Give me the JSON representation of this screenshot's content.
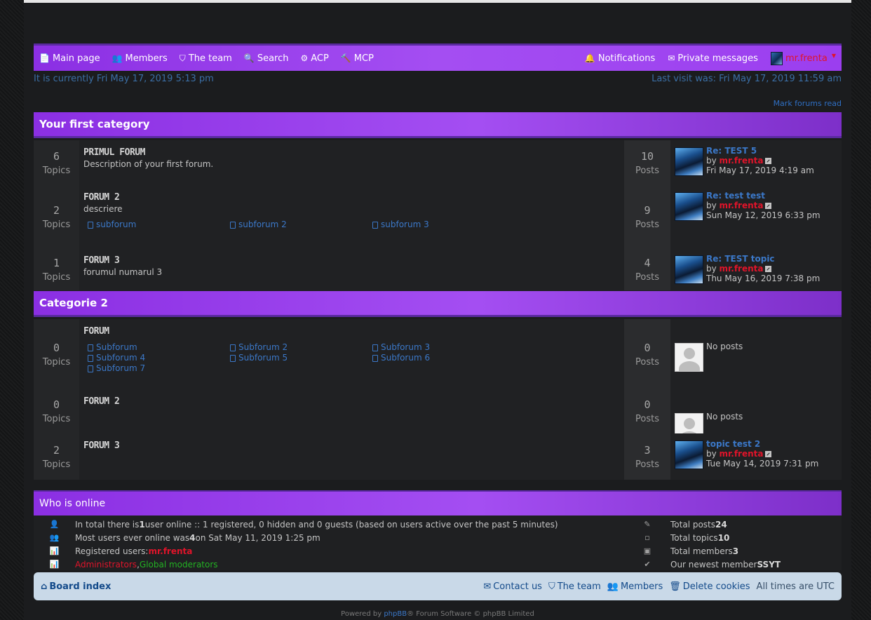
{
  "nav": {
    "items": [
      {
        "icon": "file-icon",
        "glyph": "📄",
        "label": "Main page"
      },
      {
        "icon": "members-icon",
        "glyph": "👥",
        "label": "Members"
      },
      {
        "icon": "shield-icon",
        "glyph": "⛉",
        "label": "The team"
      },
      {
        "icon": "search-icon",
        "glyph": "🔍",
        "label": "Search"
      },
      {
        "icon": "cogs-icon",
        "glyph": "⚙",
        "label": "ACP"
      },
      {
        "icon": "gavel-icon",
        "glyph": "🔨",
        "label": "MCP"
      }
    ],
    "notifications": "Notifications",
    "private_messages": "Private messages",
    "username": "mr.frenta"
  },
  "status": {
    "current_time": "It is currently Fri May 17, 2019 5:13 pm",
    "last_visit": "Last visit was: Fri May 17, 2019 11:59 am",
    "mark_read": "Mark forums read"
  },
  "categories": [
    {
      "title": "Your first category",
      "forums": [
        {
          "topics": "6",
          "topics_label": "Topics",
          "title": "PRIMUL FORUM",
          "desc": "Description of your first forum.",
          "subforums": [],
          "posts": "10",
          "posts_label": "Posts",
          "last": {
            "title": "Re: TEST 5",
            "by": "by",
            "user": "mr.frenta",
            "date": "Fri May 17, 2019 4:19 am"
          }
        },
        {
          "topics": "2",
          "topics_label": "Topics",
          "title": "FORUM 2",
          "desc": "descriere",
          "subforums": [
            "subforum",
            "subforum 2",
            "subforum 3"
          ],
          "posts": "9",
          "posts_label": "Posts",
          "last": {
            "title": "Re: test test",
            "by": "by",
            "user": "mr.frenta",
            "date": "Sun May 12, 2019 6:33 pm"
          }
        },
        {
          "topics": "1",
          "topics_label": "Topics",
          "title": "FORUM 3",
          "desc": "forumul numarul 3",
          "subforums": [],
          "posts": "4",
          "posts_label": "Posts",
          "last": {
            "title": "Re: TEST topic",
            "by": "by",
            "user": "mr.frenta",
            "date": "Thu May 16, 2019 7:38 pm"
          }
        }
      ]
    },
    {
      "title": "Categorie 2",
      "forums": [
        {
          "topics": "0",
          "topics_label": "Topics",
          "title": "FORUM",
          "desc": "",
          "subforums": [
            "Subforum",
            "Subforum 2",
            "Subforum 3",
            "Subforum 4",
            "Subforum 5",
            "Subforum 6",
            "Subforum 7"
          ],
          "posts": "0",
          "posts_label": "Posts",
          "last": {
            "none": "No posts"
          }
        },
        {
          "topics": "0",
          "topics_label": "Topics",
          "title": "FORUM 2",
          "desc": "",
          "subforums": [],
          "posts": "0",
          "posts_label": "Posts",
          "last": {
            "none": "No posts"
          }
        },
        {
          "topics": "2",
          "topics_label": "Topics",
          "title": "FORUM 3",
          "desc": "",
          "subforums": [],
          "posts": "3",
          "posts_label": "Posts",
          "last": {
            "title": "topic test 2",
            "by": "by",
            "user": "mr.frenta",
            "date": "Tue May 14, 2019 7:31 pm"
          }
        }
      ]
    }
  ],
  "online": {
    "title": "Who is online",
    "line1_a": "In total there is ",
    "line1_b": "1",
    "line1_c": " user online :: 1 registered, 0 hidden and 0 guests (based on users active over the past 5 minutes)",
    "line2_a": "Most users ever online was ",
    "line2_b": "4",
    "line2_c": " on Sat May 11, 2019 1:25 pm",
    "line3_a": "Registered users: ",
    "line3_user": "mr.frenta",
    "line4_admins": "Administrators",
    "line4_sep": ", ",
    "line4_mods": "Global moderators",
    "stats": {
      "posts_label": "Total posts ",
      "posts": "24",
      "topics_label": "Total topics ",
      "topics": "10",
      "members_label": "Total members ",
      "members": "3",
      "newest_label": "Our newest member ",
      "newest": "SSYT"
    }
  },
  "footer": {
    "board_index": "Board index",
    "contact": "Contact us",
    "team": "The team",
    "members": "Members",
    "delete_cookies": "Delete cookies",
    "timezone": "All times are UTC"
  },
  "powered": {
    "a": "Powered by ",
    "phpbb": "phpBB",
    "b": "® Forum Software © phpBB Limited"
  }
}
